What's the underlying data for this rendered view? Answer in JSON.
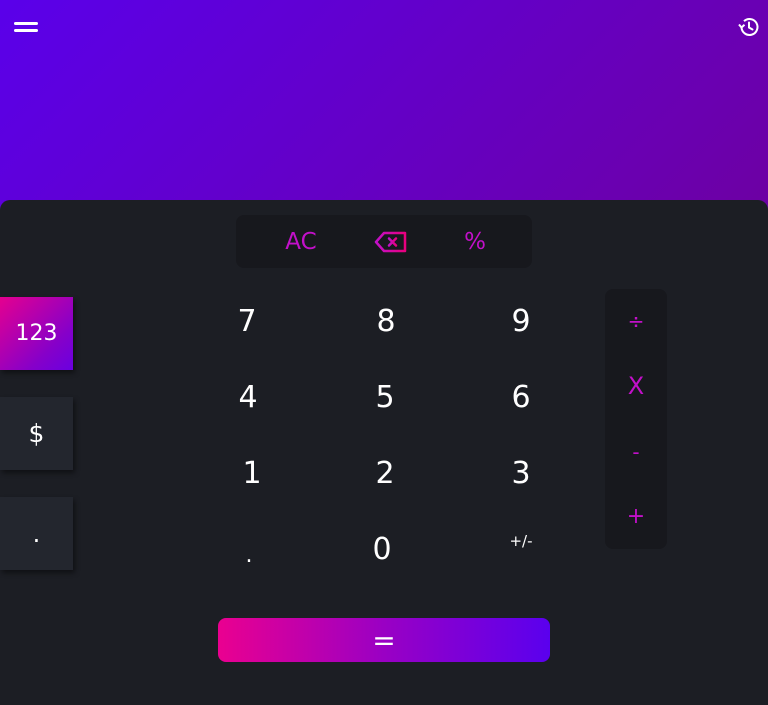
{
  "header": {
    "menu_icon": "hamburger-menu-icon",
    "history_icon": "history-icon"
  },
  "function_row": {
    "clear": "AC",
    "backspace_icon": "backspace-icon",
    "percent": "%"
  },
  "modes": {
    "numeric": "123",
    "currency": "$",
    "decimal": "."
  },
  "keypad": {
    "k7": "7",
    "k8": "8",
    "k9": "9",
    "k4": "4",
    "k5": "5",
    "k6": "6",
    "k1": "1",
    "k2": "2",
    "k3": "3",
    "kdot": ".",
    "k0": "0",
    "ksign": "+/-"
  },
  "operators": {
    "divide": "÷",
    "multiply": "X",
    "subtract": "-",
    "add": "+"
  },
  "equals": "=",
  "colors": {
    "accent": "#c210c9",
    "panel": "#1c1e24",
    "keypad_well": "#17181d"
  }
}
